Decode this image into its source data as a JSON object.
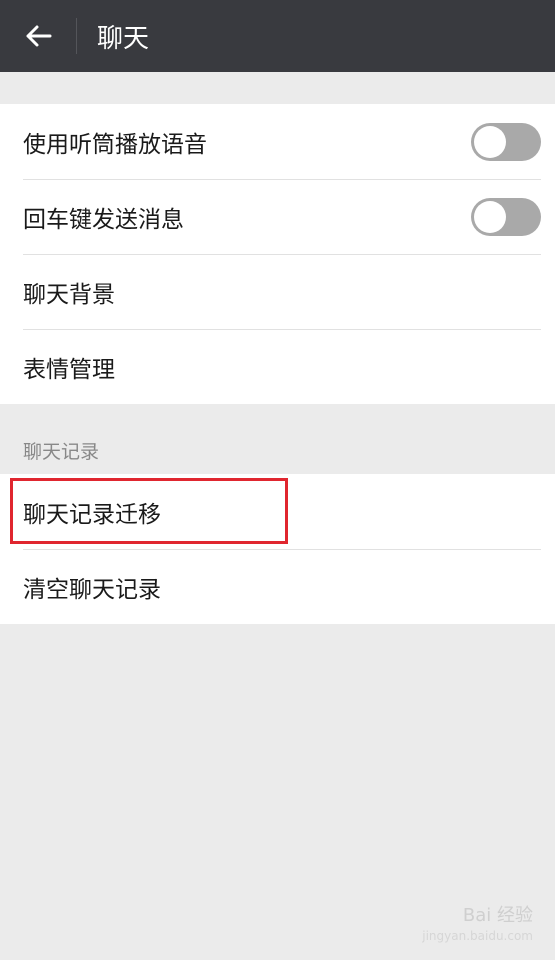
{
  "header": {
    "title": "聊天"
  },
  "settings": {
    "items": [
      {
        "label": "使用听筒播放语音",
        "toggle": true,
        "on": false
      },
      {
        "label": "回车键发送消息",
        "toggle": true,
        "on": false
      },
      {
        "label": "聊天背景",
        "toggle": false
      },
      {
        "label": "表情管理",
        "toggle": false
      }
    ]
  },
  "history": {
    "section_title": "聊天记录",
    "items": [
      {
        "label": "聊天记录迁移"
      },
      {
        "label": "清空聊天记录"
      }
    ]
  },
  "watermark": {
    "text": "Bai 经验",
    "sub": "jingyan.baidu.com"
  },
  "colors": {
    "header_bg": "#393a3f",
    "highlight": "#e0262f",
    "toggle_off": "#a9a9a9"
  }
}
